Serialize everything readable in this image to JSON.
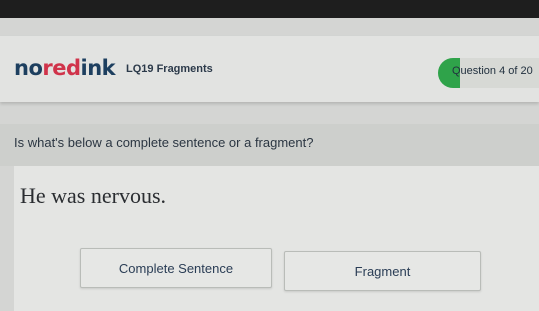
{
  "header": {
    "logo": {
      "part1": "no",
      "part2": "red",
      "part3": "ink"
    },
    "quiz_title": "LQ19 Fragments",
    "progress": {
      "label": "Question 4 of 20",
      "current": 4,
      "total": 20,
      "fill_color": "#2fa34a"
    }
  },
  "question": {
    "prompt": "Is what's below a complete sentence or a fragment?",
    "sentence": "He was nervous."
  },
  "choices": [
    {
      "label": "Complete Sentence"
    },
    {
      "label": "Fragment"
    }
  ]
}
